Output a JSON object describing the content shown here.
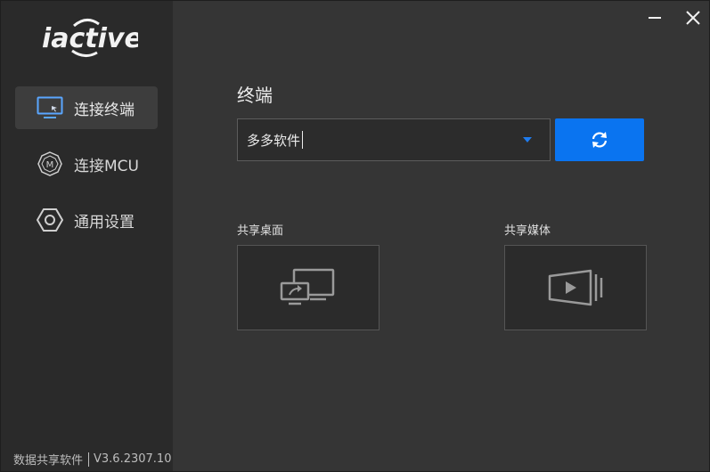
{
  "brand": {
    "logo_text": "iactive"
  },
  "sidebar": {
    "items": [
      {
        "label": "连接终端",
        "icon": "monitor-icon",
        "active": true
      },
      {
        "label": "连接MCU",
        "icon": "mcu-icon",
        "active": false
      },
      {
        "label": "通用设置",
        "icon": "settings-hexagon-icon",
        "active": false
      }
    ],
    "footer": {
      "app_name": "数据共享软件",
      "version": "V3.6.2307.10"
    }
  },
  "window_controls": {
    "minimize_icon": "minimize-icon",
    "close_icon": "close-icon"
  },
  "main": {
    "title": "终端",
    "terminal_select": {
      "value": "多多软件"
    },
    "refresh_icon": "refresh-icon",
    "cards": [
      {
        "label": "共享桌面",
        "icon": "share-desktop-icon"
      },
      {
        "label": "共享媒体",
        "icon": "share-media-icon"
      }
    ]
  },
  "colors": {
    "accent": "#0a74f0",
    "sidebar_bg": "#2a2a2a",
    "main_bg": "#353535"
  }
}
